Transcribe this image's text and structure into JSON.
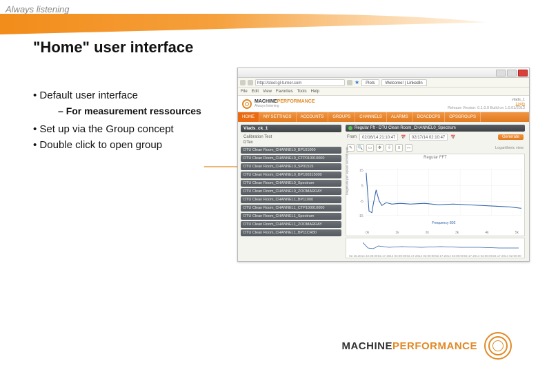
{
  "header": {
    "tagline": "Always listening"
  },
  "slide": {
    "title": "\"Home\" user interface",
    "bullets": {
      "b1": "Default user interface",
      "b1_sub": "For measurement ressources",
      "b2": "Set up via the Group concept",
      "b3": "Double click to open group"
    }
  },
  "screenshot": {
    "url": "http://stool.gl-turner.com",
    "tabs": {
      "plots": "Plots",
      "linkedin": "Welcome! | LinkedIn"
    },
    "menu": [
      "File",
      "Edit",
      "View",
      "Favorites",
      "Tools",
      "Help"
    ],
    "logo": {
      "brand1": "MACHINE",
      "brand2": "PERFORMANCE",
      "sub": "Always listening"
    },
    "release": "Release Version: 0.1.0.0 Build on 1.0.01/2013",
    "user": "vlads_1",
    "login": "Login",
    "nav": [
      "HOME",
      "MY SETTINGS",
      "ACCOUNTS",
      "GROUPS",
      "CHANNELS",
      "ALARMS",
      "DCACDCPS",
      "OPSGROUPS"
    ],
    "group_header": "Vlads_ck_1",
    "group_subs": [
      "Calibration Test",
      "DTex"
    ],
    "items": [
      "DTU Clean Room_CHANNEL0_BP101000",
      "DTU Clean Room_CHANNEL0_CTP010010000",
      "DTU Clean Room_CHANNEL0_SP01515",
      "DTU Clean Room_CHANNEL0_BP100315000",
      "DTU Clean Room_CHANNEL0_Spectrum",
      "DTU Clean Room_CHANNEL0_ZOOMARRAY",
      "DTU Clean Room_CHANNEL1_BP11000",
      "DTU Clean Room_CHANNEL1_CTP100010000",
      "DTU Clean Room_CHANNEL1_Spectrum",
      "DTU Clean Room_CHANNEL1_ZOOMARRAY",
      "DTU Clean Room_CHANNEL1_BP11CR80"
    ],
    "panel_title": "Regular Fft - DTU Clean Room_CHANNEL0_Spectrum",
    "dates": {
      "from_label": "From",
      "from": "02/16/14 21:10:47",
      "to": "02/17/14 02:10:47",
      "generate": "Generate"
    },
    "log_view": "Logarithmic view",
    "chart": {
      "title": "Regular FFT",
      "ylabel": "Magnitude per square second units"
    },
    "xticks": [
      "0k",
      "1k",
      "2k",
      "3k",
      "4k",
      "5k"
    ],
    "yticks": [
      "15",
      "5",
      "-5",
      "-15"
    ],
    "legend": "Frequency 802",
    "thumb_dates": [
      "02.15.2014 22:30:00",
      "02.17.2014 03:00:00",
      "02.17.2014 02:00:00",
      "02.17.2014 02:00:00",
      "02.17.2014 02:00:00",
      "02.17.2014 02:00:00"
    ]
  },
  "chart_data": {
    "type": "line",
    "title": "Regular FFT",
    "xlabel": "Frequency",
    "ylabel": "Magnitude per square second units",
    "x": [
      0,
      200,
      400,
      600,
      800,
      1000,
      1500,
      2000,
      2500,
      3000,
      3500,
      4000,
      4500,
      5000
    ],
    "y": [
      12,
      -10,
      -13,
      0,
      -7,
      -8,
      -7,
      -8,
      -8,
      -7,
      -8,
      -9,
      -9,
      -10
    ],
    "xlim": [
      0,
      5000
    ],
    "ylim": [
      -15,
      15
    ],
    "legend": [
      "802"
    ]
  },
  "footer": {
    "brand1": "MACHINE",
    "brand2": "PERFORMANCE"
  }
}
